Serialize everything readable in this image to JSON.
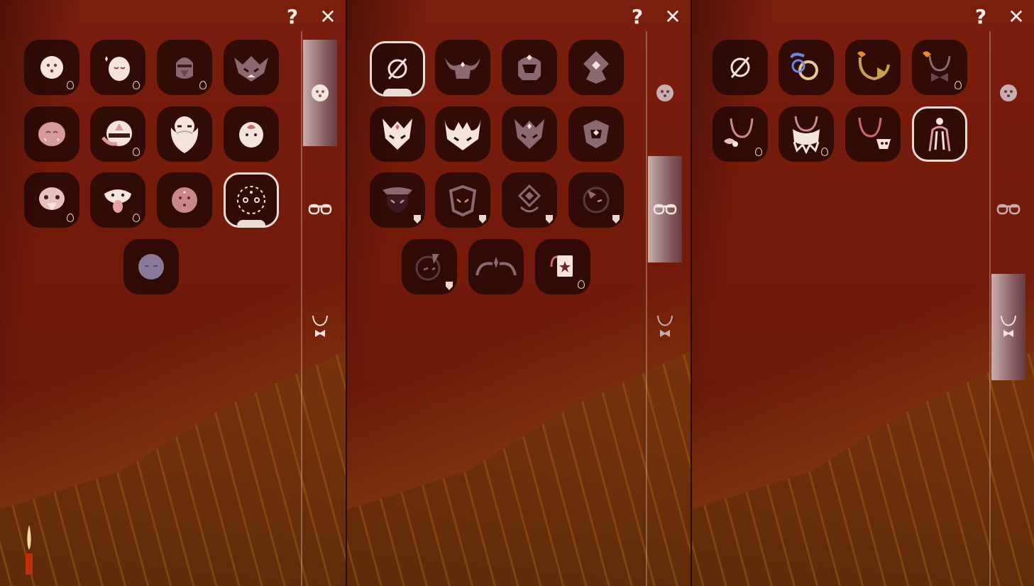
{
  "controls": {
    "help_glyph": "?",
    "close_glyph": "✕"
  },
  "colors": {
    "background": "#6a1a0c",
    "slot": "#1e0604",
    "icon": "#f4e4dc",
    "accent_orange": "#e88a2a",
    "accent_blue": "#6a88e8"
  },
  "sidebar_tabs": [
    {
      "name": "mask",
      "icon": "mask-face-icon"
    },
    {
      "name": "glasses",
      "icon": "glasses-icon"
    },
    {
      "name": "necklace",
      "icon": "necklace-icon"
    }
  ],
  "panels": [
    {
      "id": "panel-masks",
      "active_tab": "mask",
      "items": [
        {
          "icon": "round-mask-dots-icon",
          "badge": "drop"
        },
        {
          "icon": "sleepy-mask-sparkle-icon",
          "badge": "drop"
        },
        {
          "icon": "hooded-mask-icon",
          "badge": "drop"
        },
        {
          "icon": "horned-demon-mask-icon",
          "badge": ""
        },
        {
          "icon": "blush-mask-icon",
          "badge": ""
        },
        {
          "icon": "bandana-mask-icon",
          "badge": "drop"
        },
        {
          "icon": "bearded-elder-mask-icon",
          "badge": ""
        },
        {
          "icon": "flame-forehead-mask-icon",
          "badge": ""
        },
        {
          "icon": "beak-mask-icon",
          "badge": "drop"
        },
        {
          "icon": "bird-beak-mask-icon",
          "badge": "drop"
        },
        {
          "icon": "spotted-mask-icon",
          "badge": ""
        },
        {
          "icon": "dashed-circle-mask-icon",
          "badge": "",
          "selected": true
        },
        {
          "icon": "purple-sleepy-mask-icon",
          "badge": ""
        }
      ]
    },
    {
      "id": "panel-horns",
      "active_tab": "glasses",
      "items": [
        {
          "icon": "none-icon",
          "badge": "",
          "selected": true
        },
        {
          "icon": "bull-horns-icon",
          "badge": ""
        },
        {
          "icon": "helmet-crest-icon",
          "badge": ""
        },
        {
          "icon": "diamond-crest-icon",
          "badge": ""
        },
        {
          "icon": "spiked-crown-mask-icon",
          "badge": ""
        },
        {
          "icon": "horned-crown-mask-icon",
          "badge": ""
        },
        {
          "icon": "pointed-helm-mask-icon",
          "badge": ""
        },
        {
          "icon": "ornate-helm-icon",
          "badge": ""
        },
        {
          "icon": "crown-face-icon",
          "badge": "shield"
        },
        {
          "icon": "armored-face-icon",
          "badge": "shield"
        },
        {
          "icon": "diamond-face-icon",
          "badge": "shield"
        },
        {
          "icon": "half-moon-face-icon",
          "badge": "shield"
        },
        {
          "icon": "bolt-face-icon",
          "badge": "shield"
        },
        {
          "icon": "antler-star-icon",
          "badge": ""
        },
        {
          "icon": "star-card-icon",
          "badge": "drop"
        }
      ]
    },
    {
      "id": "panel-necklaces",
      "active_tab": "necklace",
      "items": [
        {
          "icon": "none-icon",
          "badge": ""
        },
        {
          "icon": "blue-orb-necklace-icon",
          "badge": ""
        },
        {
          "icon": "golden-pendant-icon",
          "badge": ""
        },
        {
          "icon": "fire-bow-necklace-icon",
          "badge": "drop"
        },
        {
          "icon": "bead-necklace-icon",
          "badge": "drop"
        },
        {
          "icon": "scarf-necklace-icon",
          "badge": "drop"
        },
        {
          "icon": "charm-necklace-icon",
          "badge": ""
        },
        {
          "icon": "cape-pendant-icon",
          "badge": "",
          "selected": true
        }
      ]
    }
  ]
}
